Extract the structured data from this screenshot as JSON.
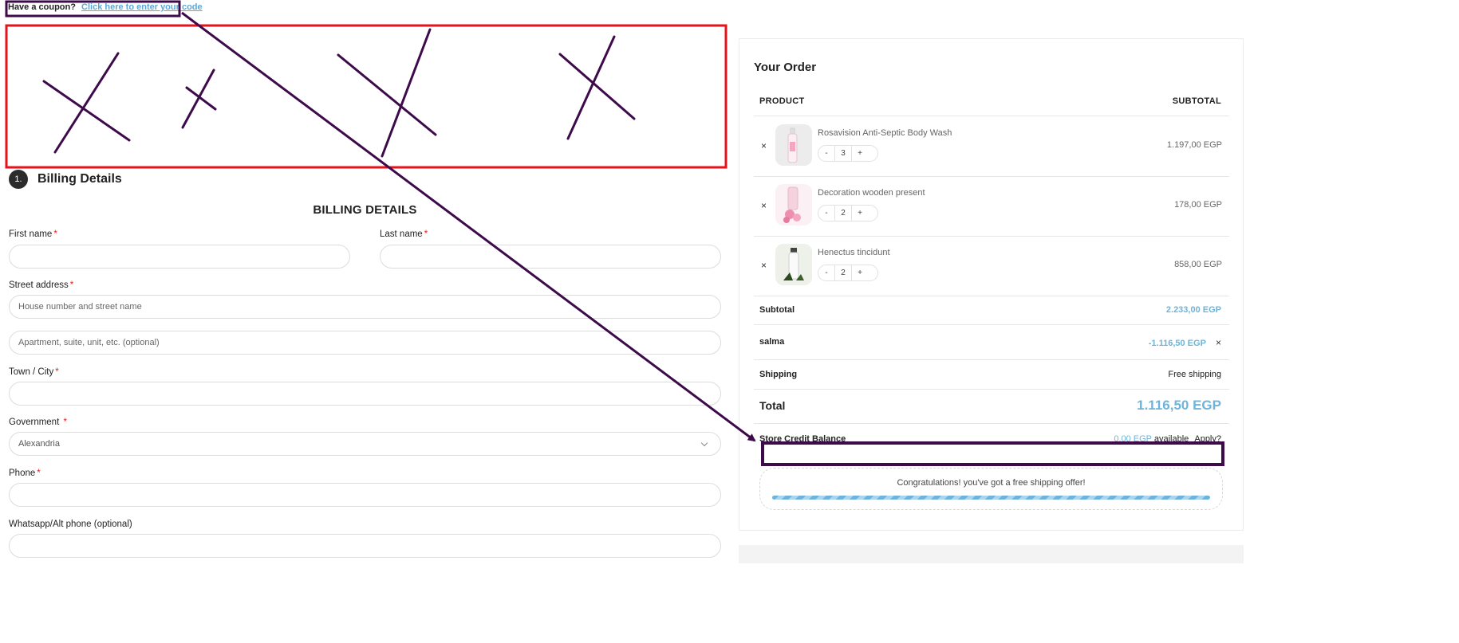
{
  "coupon": {
    "prompt": "Have a coupon?",
    "link": "Click here to enter your code"
  },
  "billing": {
    "step_number": "1.",
    "section_title": "Billing Details",
    "heading": "BILLING DETAILS",
    "required_mark": "*",
    "first_name": {
      "label": "First name",
      "value": ""
    },
    "last_name": {
      "label": "Last name",
      "value": ""
    },
    "street": {
      "label": "Street address",
      "placeholder": "House number and street name"
    },
    "apartment": {
      "placeholder": "Apartment, suite, unit, etc. (optional)"
    },
    "town": {
      "label": "Town / City",
      "value": ""
    },
    "government": {
      "label": "Government",
      "selected": "Alexandria"
    },
    "phone": {
      "label": "Phone",
      "value": ""
    },
    "alt_phone": {
      "label": "Whatsapp/Alt phone (optional)",
      "value": ""
    }
  },
  "order": {
    "title": "Your Order",
    "col_product": "PRODUCT",
    "col_subtotal": "SUBTOTAL",
    "remove_symbol": "×",
    "items": [
      {
        "name": "Rosavision Anti-Septic Body Wash",
        "qty": "3",
        "price": "1.197,00 EGP",
        "minus": "-",
        "plus": "+"
      },
      {
        "name": "Decoration wooden present",
        "qty": "2",
        "price": "178,00 EGP",
        "minus": "-",
        "plus": "+"
      },
      {
        "name": "Henectus tincidunt",
        "qty": "2",
        "price": "858,00 EGP",
        "minus": "-",
        "plus": "+"
      }
    ],
    "subtotal": {
      "label": "Subtotal",
      "value": "2.233,00 EGP"
    },
    "coupon_line": {
      "label": "salma",
      "value": "-1.116,50 EGP",
      "remove": "×"
    },
    "shipping": {
      "label": "Shipping",
      "value": "Free shipping"
    },
    "total": {
      "label": "Total",
      "value": "1.116,50 EGP"
    },
    "store_credit": {
      "label": "Store Credit Balance",
      "amount": "0,00 EGP",
      "available": "available",
      "apply": "Apply?"
    },
    "free_shipping_msg": "Congratulations! you've got a free shipping offer!",
    "free_shipping_progress": 1.0
  },
  "colors": {
    "accent": "#6cb4dc",
    "required": "#e02020",
    "annotation_red": "#e8121a",
    "annotation_purple": "#3d0a4a"
  }
}
